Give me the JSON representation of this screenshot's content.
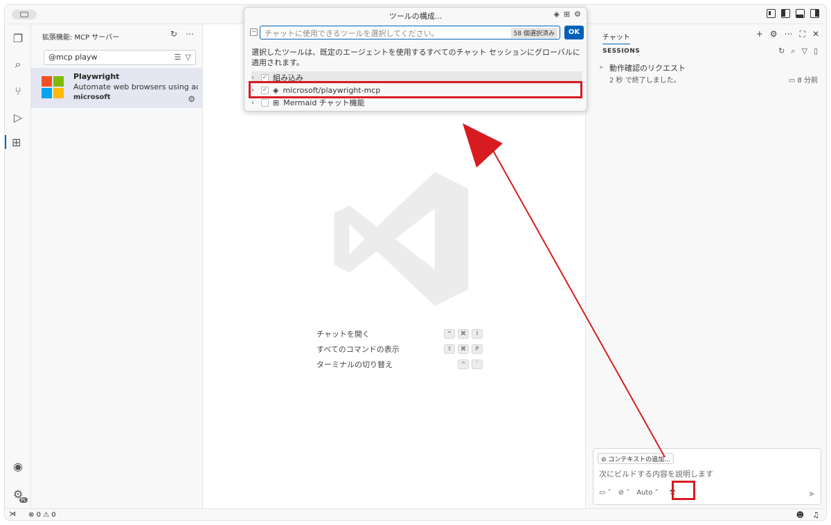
{
  "quickpick": {
    "title": "ツールの構成...",
    "placeholder": "チャットに使用できるツールを選択してください。",
    "count_badge": "58 個選択済み",
    "ok_label": "OK",
    "description": "選択したツールは、既定のエージェントを使用するすべてのチャット セッションにグローバルに適用されます。",
    "items": [
      {
        "label": "組み込み",
        "checked": true
      },
      {
        "label": "microsoft/playwright-mcp",
        "checked": true
      },
      {
        "label": "Mermaid チャット機能",
        "checked": false
      }
    ]
  },
  "sidebar": {
    "header": "拡張機能: MCP サーバー",
    "search_value": "@mcp playw",
    "extension": {
      "name": "Playwright",
      "description": "Automate web browsers using ac...",
      "publisher": "microsoft"
    }
  },
  "editor": {
    "shortcuts": [
      {
        "label": "チャットを開く",
        "keys": [
          "^",
          "⌘",
          "I"
        ]
      },
      {
        "label": "すべてのコマンドの表示",
        "keys": [
          "⇧",
          "⌘",
          "P"
        ]
      },
      {
        "label": "ターミナルの切り替え",
        "keys": [
          "^",
          "`"
        ]
      }
    ]
  },
  "chat": {
    "tab_label": "チャット",
    "sessions_title": "SESSIONS",
    "session": {
      "title": "動作確認のリクエスト",
      "subtitle": "2 秒 で終了しました。",
      "time": "8 分前"
    },
    "add_context": "コンテキストの追加...",
    "input_placeholder": "次にビルドする内容を説明します",
    "mode_label": "Auto"
  },
  "statusbar": {
    "errors": "0",
    "warnings": "0"
  },
  "activity": {
    "account_badge": "PL"
  },
  "colors": {
    "accent": "#005fb8",
    "highlight_red": "#d71b21"
  }
}
